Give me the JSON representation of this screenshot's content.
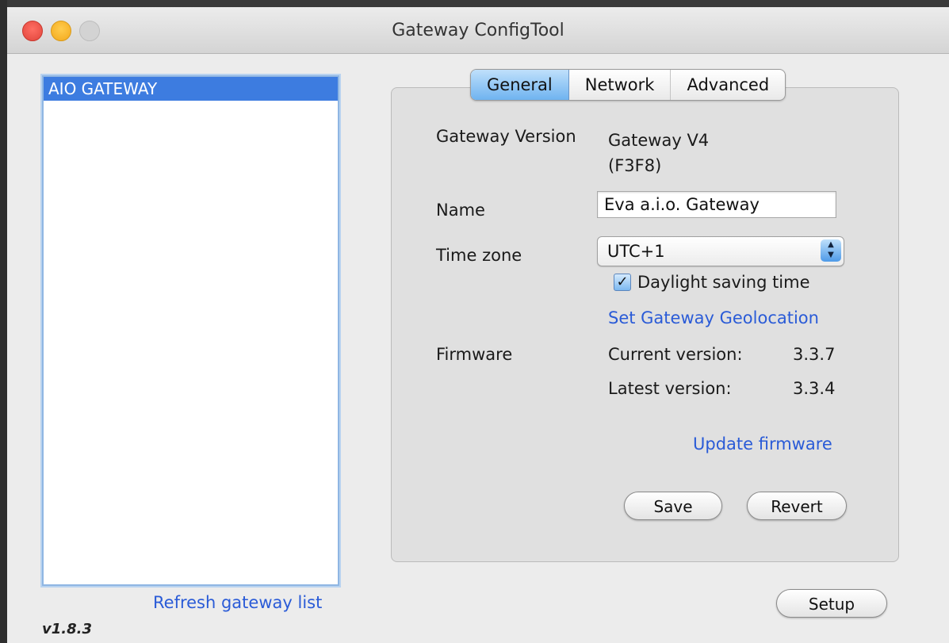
{
  "window": {
    "title": "Gateway ConfigTool"
  },
  "gateway_list": {
    "items": [
      "AIO GATEWAY"
    ],
    "refresh_label": "Refresh gateway list"
  },
  "app_version": "v1.8.3",
  "tabs": [
    {
      "label": "General",
      "active": true
    },
    {
      "label": "Network",
      "active": false
    },
    {
      "label": "Advanced",
      "active": false
    }
  ],
  "general": {
    "gateway_version_label": "Gateway Version",
    "gateway_version_value_line1": "Gateway V4",
    "gateway_version_value_line2": "(F3F8)",
    "name_label": "Name",
    "name_value": "Eva a.i.o. Gateway",
    "timezone_label": "Time zone",
    "timezone_value": "UTC+1",
    "daylight_saving_label": "Daylight saving time",
    "daylight_saving_checked": true,
    "geolocation_link": "Set Gateway Geolocation",
    "firmware_label": "Firmware",
    "current_version_label": "Current version:",
    "current_version_value": "3.3.7",
    "latest_version_label": "Latest version:",
    "latest_version_value": "3.3.4",
    "update_firmware_link": "Update firmware",
    "save_label": "Save",
    "revert_label": "Revert"
  },
  "setup_label": "Setup",
  "colors": {
    "accent": "#3d7ce0",
    "link": "#2a5bd7",
    "close": "#ff6e63",
    "minimize": "#ffcc4d"
  }
}
